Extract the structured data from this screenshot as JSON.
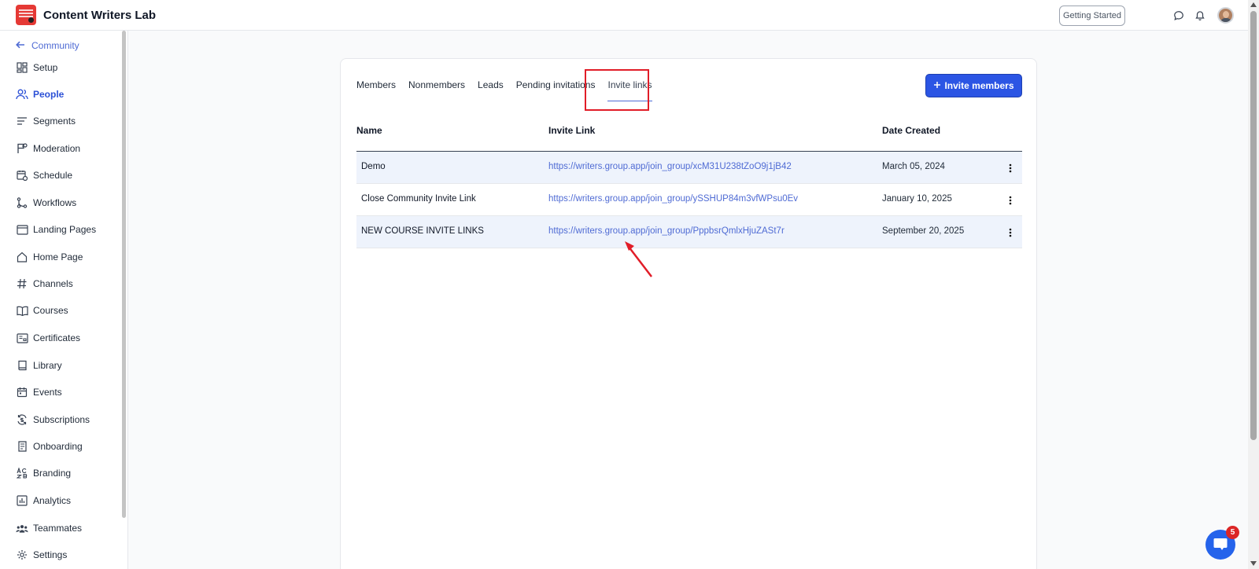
{
  "header": {
    "app_title": "Content Writers Lab",
    "getting_started_label": "Getting Started"
  },
  "sidebar": {
    "back_label": "Community",
    "items": [
      {
        "label": "Setup",
        "icon": "grid-icon"
      },
      {
        "label": "People",
        "icon": "people-icon",
        "active": true
      },
      {
        "label": "Segments",
        "icon": "segments-icon"
      },
      {
        "label": "Moderation",
        "icon": "flag-icon"
      },
      {
        "label": "Schedule",
        "icon": "calendar-clock-icon"
      },
      {
        "label": "Workflows",
        "icon": "workflow-icon"
      },
      {
        "label": "Landing Pages",
        "icon": "browser-icon"
      },
      {
        "label": "Home Page",
        "icon": "home-icon"
      },
      {
        "label": "Channels",
        "icon": "hash-icon"
      },
      {
        "label": "Courses",
        "icon": "book-open-icon"
      },
      {
        "label": "Certificates",
        "icon": "certificate-icon"
      },
      {
        "label": "Library",
        "icon": "library-icon"
      },
      {
        "label": "Events",
        "icon": "calendar-icon"
      },
      {
        "label": "Subscriptions",
        "icon": "subscription-icon"
      },
      {
        "label": "Onboarding",
        "icon": "onboarding-icon"
      },
      {
        "label": "Branding",
        "icon": "branding-icon"
      },
      {
        "label": "Analytics",
        "icon": "analytics-icon"
      },
      {
        "label": "Teammates",
        "icon": "teammates-icon"
      },
      {
        "label": "Settings",
        "icon": "gear-icon"
      }
    ]
  },
  "main": {
    "tabs": [
      {
        "label": "Members"
      },
      {
        "label": "Nonmembers"
      },
      {
        "label": "Leads"
      },
      {
        "label": "Pending invitations"
      },
      {
        "label": "Invite links",
        "active": true
      }
    ],
    "invite_button_label": "Invite members",
    "table": {
      "columns": [
        "Name",
        "Invite Link",
        "Date Created"
      ],
      "rows": [
        {
          "name": "Demo",
          "link": "https://writers.group.app/join_group/xcM31U238tZoO9j1jB42",
          "date": "March 05, 2024"
        },
        {
          "name": "Close Community Invite Link",
          "link": "https://writers.group.app/join_group/ySSHUP84m3vfWPsu0Ev",
          "date": "January 10, 2025"
        },
        {
          "name": "NEW COURSE INVITE LINKS",
          "link": "https://writers.group.app/join_group/PppbsrQmlxHjuZASt7r",
          "date": "September 20, 2025"
        }
      ]
    }
  },
  "chat": {
    "badge_count": "5"
  },
  "colors": {
    "accent": "#2b55e4",
    "highlight": "#e11d28",
    "link": "#4f6bd4"
  }
}
